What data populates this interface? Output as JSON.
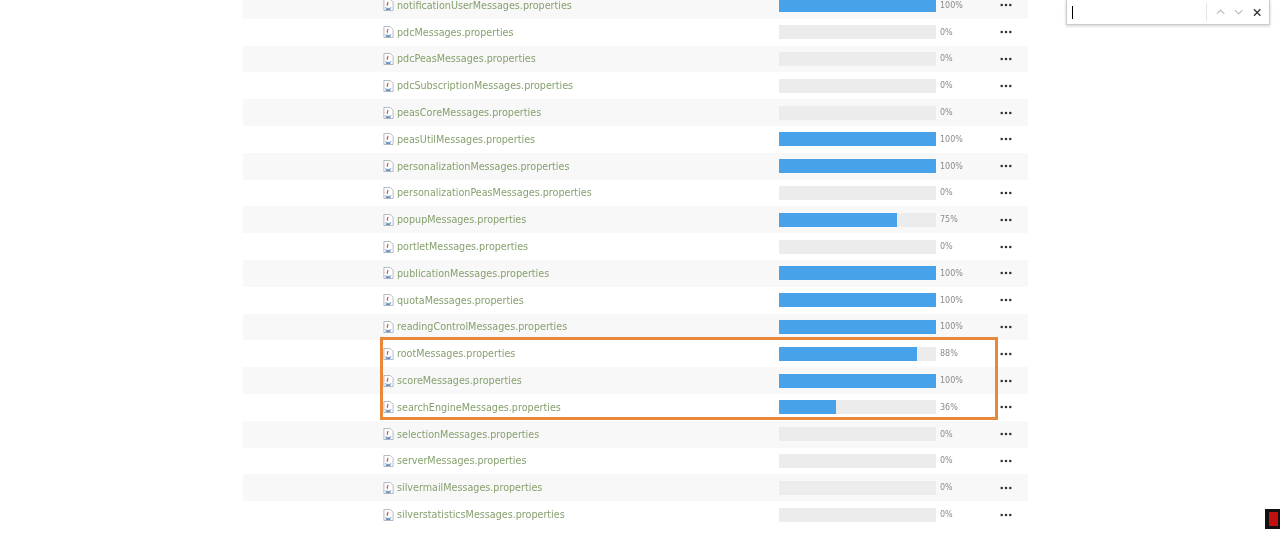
{
  "rows": [
    {
      "name": "notificationUserMessages.properties",
      "level": 1,
      "percent": "100%",
      "highlighted": false
    },
    {
      "name": "pdcMessages.properties",
      "level": 0,
      "percent": "0%",
      "highlighted": false
    },
    {
      "name": "pdcPeasMessages.properties",
      "level": 0,
      "percent": "0%",
      "highlighted": false
    },
    {
      "name": "pdcSubscriptionMessages.properties",
      "level": 0,
      "percent": "0%",
      "highlighted": false
    },
    {
      "name": "peasCoreMessages.properties",
      "level": 0,
      "percent": "0%",
      "highlighted": false
    },
    {
      "name": "peasUtilMessages.properties",
      "level": 1,
      "percent": "100%",
      "highlighted": false
    },
    {
      "name": "personalizationMessages.properties",
      "level": 1,
      "percent": "100%",
      "highlighted": false
    },
    {
      "name": "personalizationPeasMessages.properties",
      "level": 0,
      "percent": "0%",
      "highlighted": false
    },
    {
      "name": "popupMessages.properties",
      "level": 0.75,
      "percent": "75%",
      "highlighted": false
    },
    {
      "name": "portletMessages.properties",
      "level": 0,
      "percent": "0%",
      "highlighted": false
    },
    {
      "name": "publicationMessages.properties",
      "level": 1,
      "percent": "100%",
      "highlighted": false
    },
    {
      "name": "quotaMessages.properties",
      "level": 1,
      "percent": "100%",
      "highlighted": false
    },
    {
      "name": "readingControlMessages.properties",
      "level": 1,
      "percent": "100%",
      "highlighted": false
    },
    {
      "name": "rootMessages.properties",
      "level": 0.88,
      "percent": "88%",
      "highlighted": true
    },
    {
      "name": "scoreMessages.properties",
      "level": 1,
      "percent": "100%",
      "highlighted": true
    },
    {
      "name": "searchEngineMessages.properties",
      "level": 0.36,
      "percent": "36%",
      "highlighted": true
    },
    {
      "name": "selectionMessages.properties",
      "level": 0,
      "percent": "0%",
      "highlighted": false
    },
    {
      "name": "serverMessages.properties",
      "level": 0,
      "percent": "0%",
      "highlighted": false
    },
    {
      "name": "silvermailMessages.properties",
      "level": 0,
      "percent": "0%",
      "highlighted": false
    },
    {
      "name": "silverstatisticsMessages.properties",
      "level": 0,
      "percent": "0%",
      "highlighted": false
    }
  ]
}
